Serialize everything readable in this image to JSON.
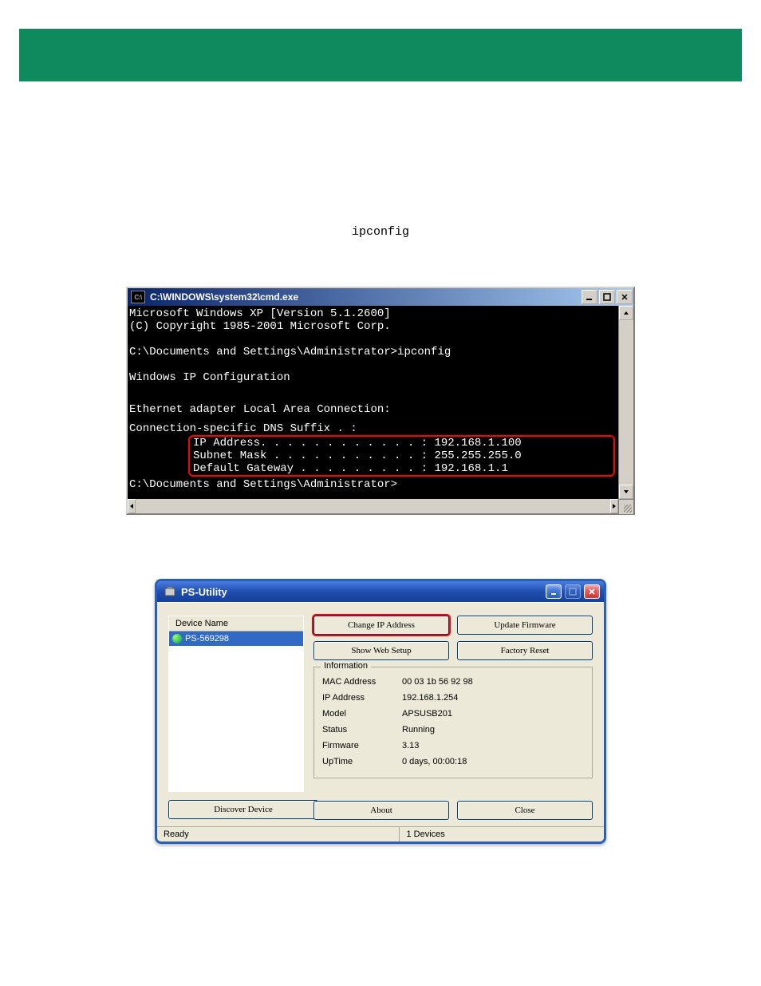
{
  "header_text": "ipconfig",
  "cmd": {
    "title": "C:\\WINDOWS\\system32\\cmd.exe",
    "sysicon_label": "C:\\",
    "lines": {
      "l1": "Microsoft Windows XP [Version 5.1.2600]",
      "l2": "(C) Copyright 1985-2001 Microsoft Corp.",
      "l3": "C:\\Documents and Settings\\Administrator>ipconfig",
      "l4": "Windows IP Configuration",
      "l5": "Ethernet adapter Local Area Connection:",
      "l6": "        Connection-specific DNS Suffix  . :",
      "l7": "IP Address. . . . . . . . . . . . : 192.168.1.100",
      "l8": "Subnet Mask . . . . . . . . . . . : 255.255.255.0",
      "l9": "Default Gateway . . . . . . . . . : 192.168.1.1",
      "l10": "C:\\Documents and Settings\\Administrator>"
    }
  },
  "ps": {
    "title": "PS-Utility",
    "device_header": "Device Name",
    "device_selected": "PS-569298",
    "buttons": {
      "change_ip": "Change IP Address",
      "update_fw": "Update Firmware",
      "show_web": "Show Web Setup",
      "factory_reset": "Factory Reset",
      "discover": "Discover Device",
      "about": "About",
      "close": "Close"
    },
    "group_label": "Information",
    "info": {
      "mac_k": "MAC Address",
      "mac_v": "00 03 1b 56 92 98",
      "ip_k": "IP Address",
      "ip_v": "192.168.1.254",
      "model_k": "Model",
      "model_v": "APSUSB201",
      "status_k": "Status",
      "status_v": "Running",
      "fw_k": "Firmware",
      "fw_v": "3.13",
      "up_k": "UpTime",
      "up_v": "0 days, 00:00:18"
    },
    "status_left": "Ready",
    "status_right": "1 Devices"
  }
}
